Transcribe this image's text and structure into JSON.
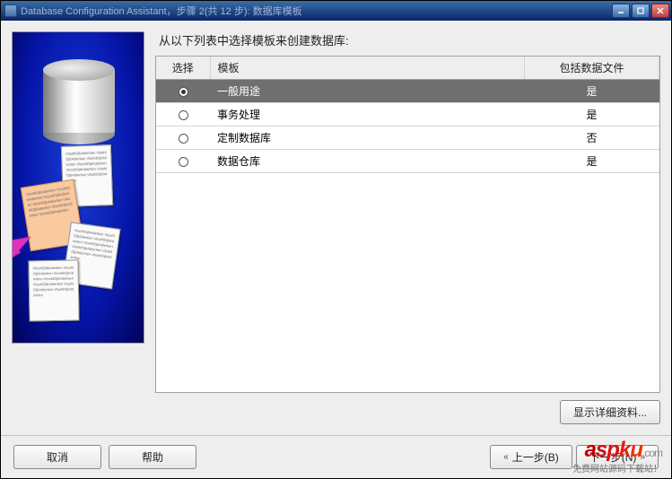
{
  "window": {
    "title": "Database Configuration Assistant，步骤 2(共 12 步): 数据库模板"
  },
  "instruction": "从以下列表中选择模板来创建数据库:",
  "table": {
    "headers": {
      "select": "选择",
      "template": "模板",
      "includes": "包括数据文件"
    },
    "rows": [
      {
        "template": "一般用途",
        "includes": "是",
        "checked": true
      },
      {
        "template": "事务处理",
        "includes": "是",
        "checked": false
      },
      {
        "template": "定制数据库",
        "includes": "否",
        "checked": false
      },
      {
        "template": "数据仓库",
        "includes": "是",
        "checked": false
      }
    ]
  },
  "buttons": {
    "details": "显示详细资料...",
    "cancel": "取消",
    "help": "帮助",
    "back": "上一步(B)",
    "next": "下一步(N)"
  },
  "watermark": {
    "sub": "免费网站源码下载站！"
  },
  "doc_filler": "VloohlOjbAdiertien VloohlOjbAdiertien VloohlOjbAdiertien VloohlOjbAdiertien VloohlOjbAdiertien VloohlOjbAdiertien VloohlOjbAdiertien"
}
